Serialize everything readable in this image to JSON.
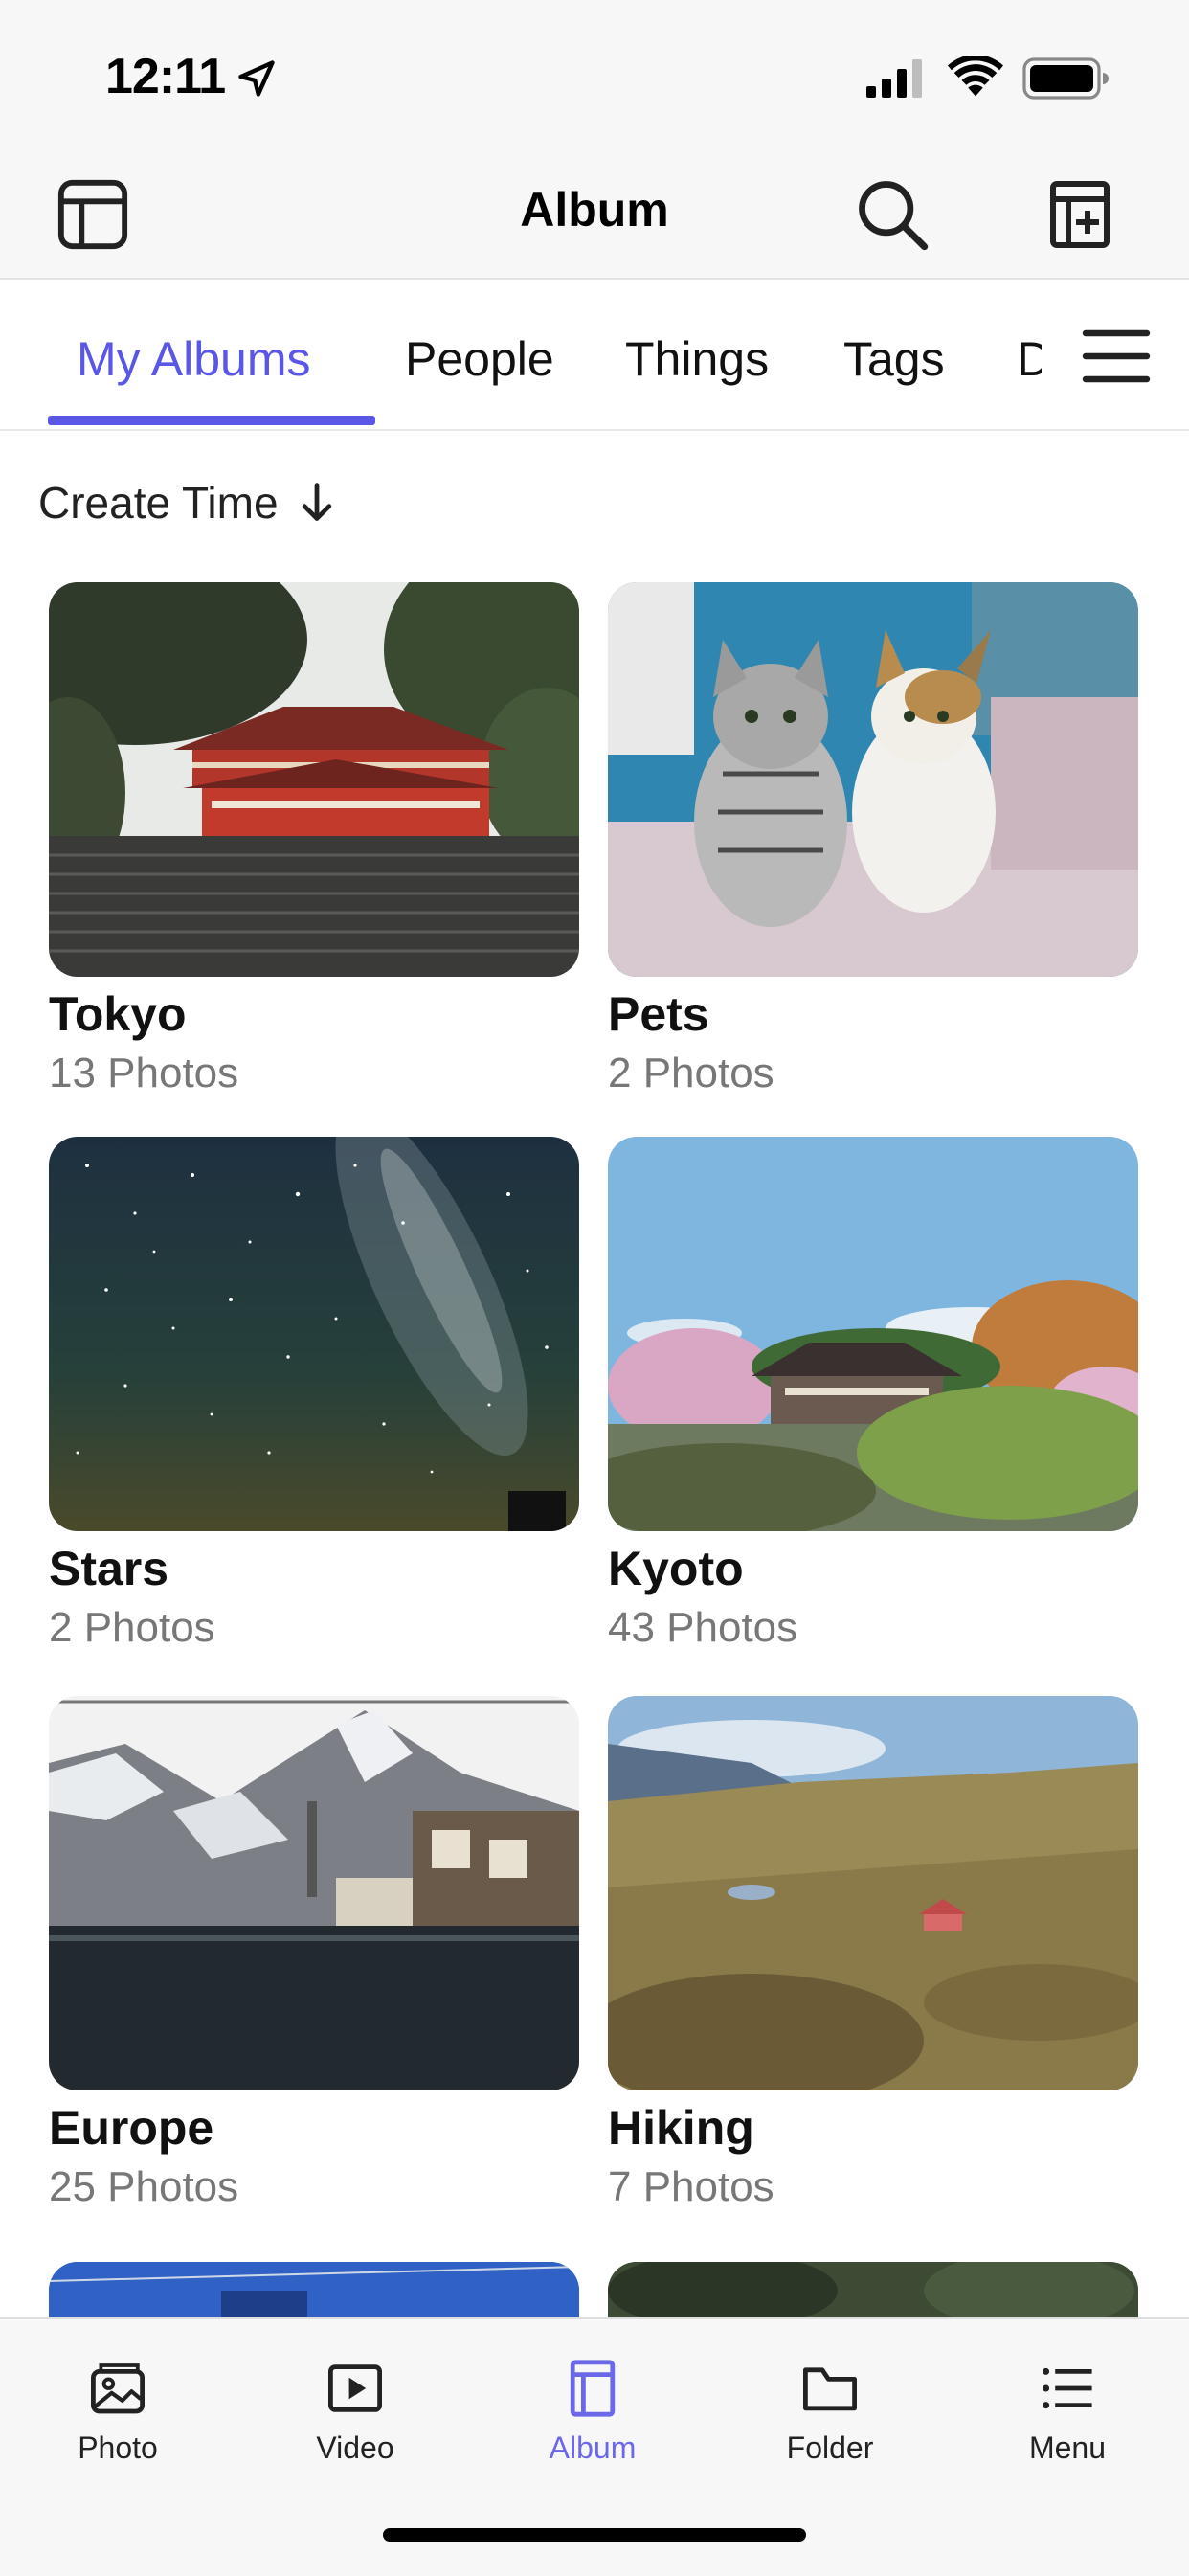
{
  "status": {
    "time": "12:11"
  },
  "nav": {
    "title": "Album"
  },
  "tabs": [
    "My Albums",
    "People",
    "Things",
    "Tags",
    "D"
  ],
  "sort": {
    "label": "Create Time"
  },
  "albums": [
    {
      "name": "Tokyo",
      "count": "13 Photos"
    },
    {
      "name": "Pets",
      "count": "2 Photos"
    },
    {
      "name": "Stars",
      "count": "2 Photos"
    },
    {
      "name": "Kyoto",
      "count": "43 Photos"
    },
    {
      "name": "Europe",
      "count": "25 Photos"
    },
    {
      "name": "Hiking",
      "count": "7 Photos"
    }
  ],
  "bottom_tabs": [
    {
      "label": "Photo",
      "icon": "photo-icon"
    },
    {
      "label": "Video",
      "icon": "video-icon"
    },
    {
      "label": "Album",
      "icon": "album-icon"
    },
    {
      "label": "Folder",
      "icon": "folder-icon"
    },
    {
      "label": "Menu",
      "icon": "menu-icon"
    }
  ],
  "active_tab": "My Albums",
  "active_bottom_tab": "Album",
  "colors": {
    "accent": "#5a57e6",
    "bar_bg": "#f7f7f7"
  }
}
